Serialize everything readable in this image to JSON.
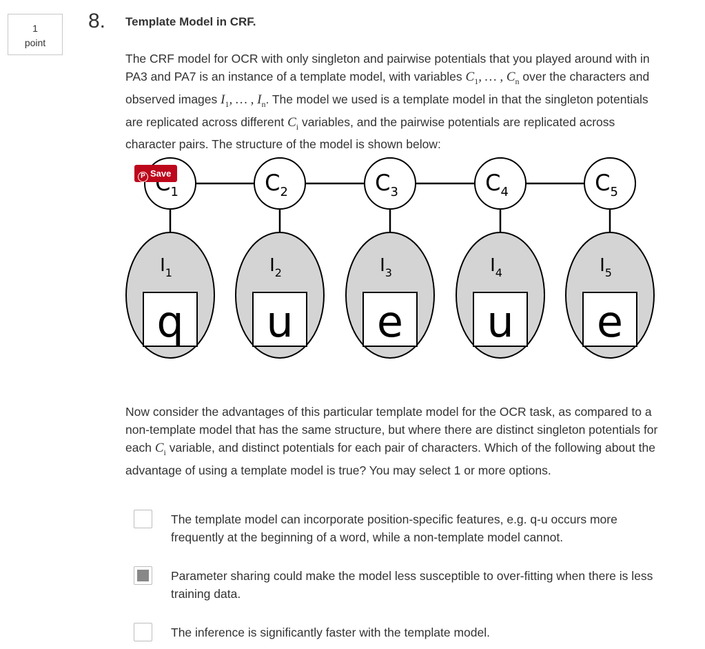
{
  "points": {
    "value": "1",
    "label": "point"
  },
  "question": {
    "number": "8.",
    "title": "Template Model in CRF.",
    "intro": {
      "t1": "The CRF model for OCR with only singleton and pairwise potentials that you played around with in PA3 and PA7 is an instance of a template model, with variables ",
      "t2": " over the characters and observed images ",
      "t3": ". The model we used is a template model in that the singleton potentials are replicated across different ",
      "t4": " variables, and the pairwise potentials are replicated across character pairs. The structure of the model is shown below:"
    },
    "followup": {
      "t1": "Now consider the advantages of this particular template model for the OCR task, as compared to a non-template model that has the same structure, but where there are distinct singleton potentials for each ",
      "t2": " variable, and distinct potentials for each pair of characters. Which of the following about the advantage of using a template model is true? You may select 1 or more options."
    }
  },
  "diagram": {
    "nodes": [
      {
        "c": "C",
        "c_sub": "1",
        "i": "I",
        "i_sub": "1",
        "char": "q"
      },
      {
        "c": "C",
        "c_sub": "2",
        "i": "I",
        "i_sub": "2",
        "char": "u"
      },
      {
        "c": "C",
        "c_sub": "3",
        "i": "I",
        "i_sub": "3",
        "char": "e"
      },
      {
        "c": "C",
        "c_sub": "4",
        "i": "I",
        "i_sub": "4",
        "char": "u"
      },
      {
        "c": "C",
        "c_sub": "5",
        "i": "I",
        "i_sub": "5",
        "char": "e"
      }
    ]
  },
  "save_button": {
    "label": "Save",
    "color": "#bd081c"
  },
  "options": [
    {
      "text": "The template model can incorporate position-specific features, e.g. q-u occurs more frequently at the beginning of a word, while a non-template model cannot.",
      "checked": false
    },
    {
      "text": "Parameter sharing could make the model less susceptible to over-fitting when there is less training data.",
      "checked": true
    },
    {
      "text": "The inference is significantly faster with the template model.",
      "checked": false
    }
  ]
}
